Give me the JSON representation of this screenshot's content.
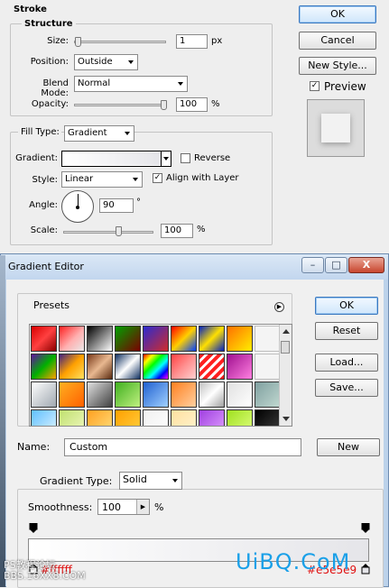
{
  "stroke": {
    "title": "Stroke",
    "structure_legend": "Structure",
    "size_label": "Size:",
    "size_value": "1",
    "size_unit": "px",
    "position_label": "Position:",
    "position_value": "Outside",
    "blend_label": "Blend Mode:",
    "blend_value": "Normal",
    "opacity_label": "Opacity:",
    "opacity_value": "100",
    "opacity_unit": "%",
    "fill_type_label": "Fill Type:",
    "fill_type_value": "Gradient",
    "gradient_label": "Gradient:",
    "reverse_label": "Reverse",
    "style_label": "Style:",
    "style_value": "Linear",
    "align_label": "Align with Layer",
    "angle_label": "Angle:",
    "angle_value": "90",
    "angle_unit": "°",
    "scale_label": "Scale:",
    "scale_value": "100",
    "scale_unit": "%",
    "ok": "OK",
    "cancel": "Cancel",
    "new_style": "New Style...",
    "preview_label": "Preview",
    "preview_checked": true,
    "reverse_checked": false,
    "align_checked": true
  },
  "gradient_editor": {
    "title": "Gradient Editor",
    "win_minimize": "–",
    "win_maximize": "□",
    "win_close": "X",
    "presets_label": "Presets",
    "ok": "OK",
    "reset": "Reset",
    "load": "Load...",
    "save": "Save...",
    "name_label": "Name:",
    "name_value": "Custom",
    "new_button": "New",
    "gradient_type_label": "Gradient Type:",
    "gradient_type_value": "Solid",
    "smoothness_label": "Smoothness:",
    "smoothness_value": "100",
    "smoothness_unit": "%",
    "stop_left_color": "#ffffff",
    "stop_right_color": "#e5e5e9"
  },
  "watermark": {
    "left_text": "PS教程论坛",
    "left_sub": "BBS.16XX8.COM",
    "right_text": "UiBQ.CoM"
  },
  "colors": {
    "default_button_border": "#3a78c0",
    "watermark_blue": "#1aa0e8",
    "title_bar": "#c2d6ee"
  }
}
